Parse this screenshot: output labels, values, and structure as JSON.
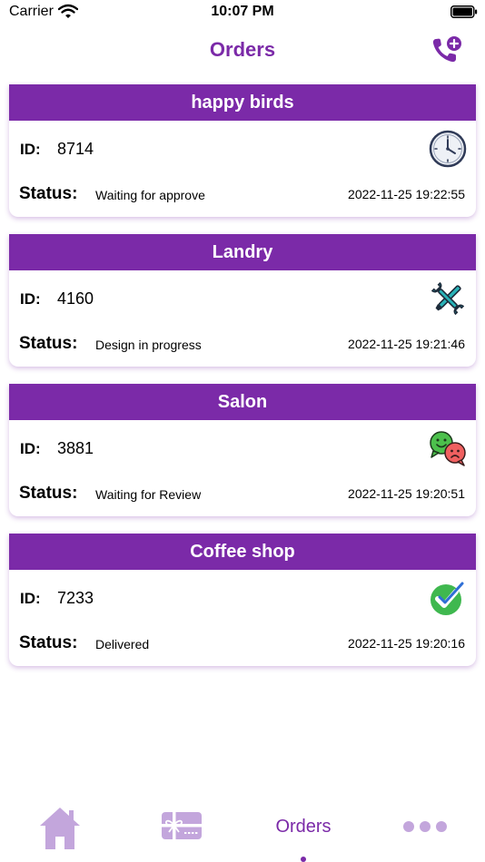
{
  "status_bar": {
    "carrier": "Carrier",
    "time": "10:07 PM"
  },
  "nav": {
    "title": "Orders"
  },
  "labels": {
    "id": "ID:",
    "status": "Status:"
  },
  "orders": [
    {
      "name": "happy birds",
      "id": "8714",
      "status": "Waiting for approve",
      "timestamp": "2022-11-25 19:22:55",
      "icon": "clock-icon"
    },
    {
      "name": "Landry",
      "id": "4160",
      "status": "Design in progress",
      "timestamp": "2022-11-25 19:21:46",
      "icon": "tools-icon"
    },
    {
      "name": "Salon",
      "id": "3881",
      "status": "Waiting for Review",
      "timestamp": "2022-11-25 19:20:51",
      "icon": "chat-faces-icon"
    },
    {
      "name": "Coffee shop",
      "id": "7233",
      "status": "Delivered",
      "timestamp": "2022-11-25 19:20:16",
      "icon": "check-circle-icon"
    }
  ],
  "tabs": {
    "orders_label": "Orders"
  },
  "colors": {
    "brand": "#7b2aa8",
    "tab_inactive": "#c3a6dc"
  }
}
